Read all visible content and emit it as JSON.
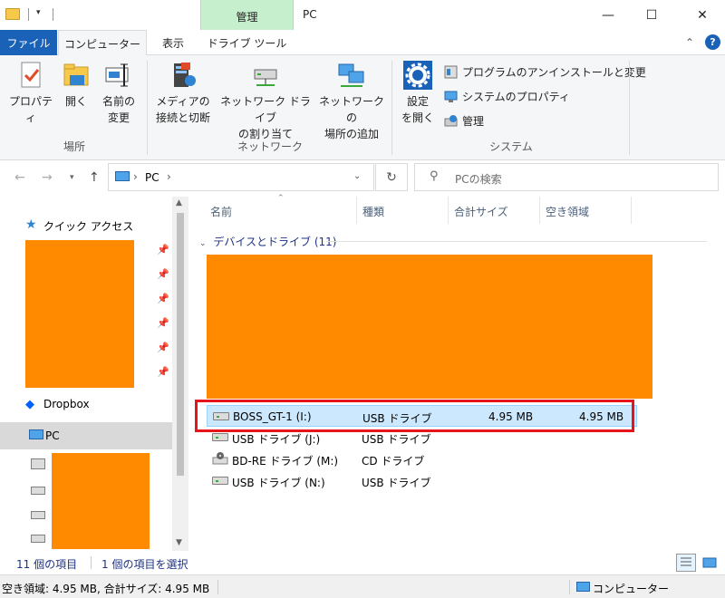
{
  "window": {
    "title": "PC",
    "context_tab": "管理",
    "qat_dropdown": "▾",
    "minimize": "—",
    "maximize": "☐",
    "close": "✕"
  },
  "ribbon_tabs": {
    "file": "ファイル",
    "computer": "コンピューター",
    "view": "表示",
    "drive_tools": "ドライブ ツール",
    "collapse": "⌃",
    "help": "?"
  },
  "ribbon": {
    "location": {
      "properties": "プロパティ",
      "open": "開く",
      "rename_l1": "名前の",
      "rename_l2": "変更",
      "label": "場所"
    },
    "network": {
      "media_l1": "メディアの",
      "media_l2": "接続と切断",
      "map_l1": "ネットワーク ドライブ",
      "map_l2": "の割り当て",
      "add_l1": "ネットワークの",
      "add_l2": "場所の追加",
      "label": "ネットワーク"
    },
    "system": {
      "settings_l1": "設定",
      "settings_l2": "を開く",
      "uninstall": "プログラムのアンインストールと変更",
      "sys_props": "システムのプロパティ",
      "manage": "管理",
      "label": "システム"
    }
  },
  "address": {
    "path_root": "PC",
    "sep1": "›",
    "sep2": "›",
    "search_placeholder": "PCの検索"
  },
  "nav_pane": {
    "quick_access": "クイック アクセス",
    "dropbox": "Dropbox",
    "pc": "PC"
  },
  "columns": {
    "name": "名前",
    "type": "種類",
    "total": "合計サイズ",
    "free": "空き領域"
  },
  "group": {
    "header": "デバイスとドライブ (11)"
  },
  "drives": [
    {
      "name": "BOSS_GT-1 (I:)",
      "type": "USB ドライブ",
      "total": "4.95 MB",
      "free": "4.95 MB"
    },
    {
      "name": "USB ドライブ (J:)",
      "type": "USB ドライブ",
      "total": "",
      "free": ""
    },
    {
      "name": "BD-RE ドライブ (M:)",
      "type": "CD ドライブ",
      "total": "",
      "free": ""
    },
    {
      "name": "USB ドライブ (N:)",
      "type": "USB ドライブ",
      "total": "",
      "free": ""
    }
  ],
  "status": {
    "count": "11 個の項目",
    "selected": "1 個の項目を選択",
    "bottom_left": "空き領域: 4.95 MB, 合計サイズ: 4.95 MB",
    "bottom_right": "コンピューター"
  },
  "colors": {
    "accent": "#1a62b8",
    "redaction": "#ff8a00",
    "highlight_box": "#e8141c",
    "selection": "#cce8ff"
  }
}
